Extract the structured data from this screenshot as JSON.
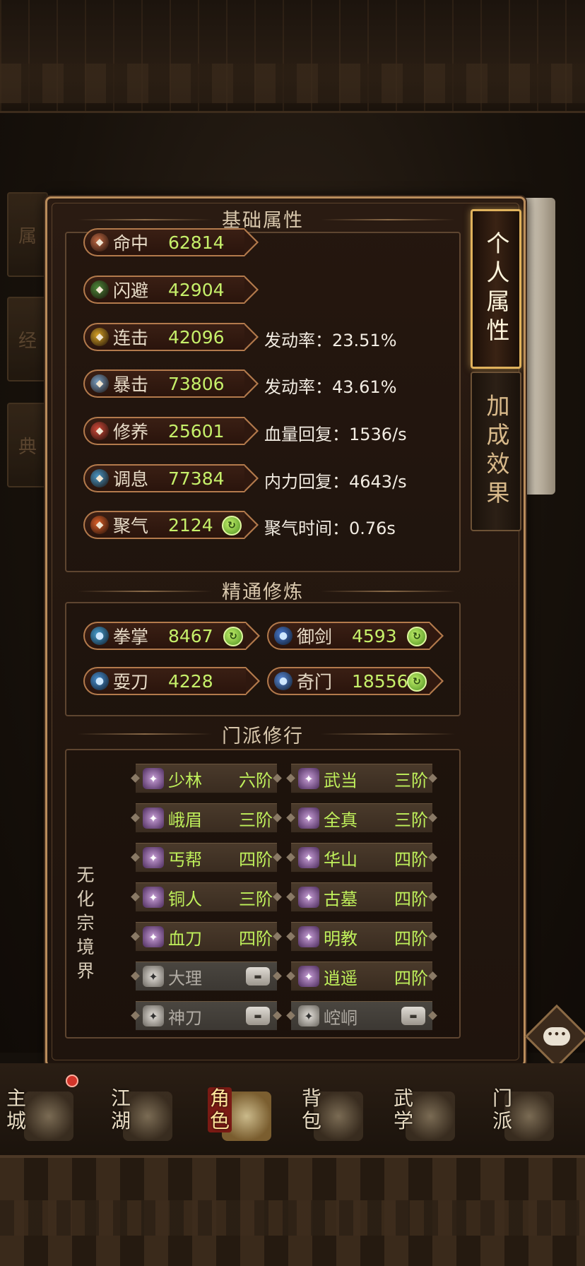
{
  "tabs": {
    "personal": "个人属性",
    "bonus": "加成效果"
  },
  "basic": {
    "title": "基础属性",
    "stats": [
      {
        "name": "命中",
        "value": "62814",
        "rate": "",
        "icon": "target-icon",
        "color": "#c26a44"
      },
      {
        "name": "闪避",
        "value": "42904",
        "rate": "",
        "icon": "dodge-icon",
        "color": "#4d8a3a"
      },
      {
        "name": "连击",
        "value": "42096",
        "rate": "发动率：23.51%",
        "icon": "lightning-icon",
        "color": "#d8a326"
      },
      {
        "name": "暴击",
        "value": "73806",
        "rate": "发动率：43.61%",
        "icon": "crit-icon",
        "color": "#7aa0c4"
      },
      {
        "name": "修养",
        "value": "25601",
        "rate": "血量回复：1536/s",
        "icon": "heart-icon",
        "color": "#d44a3a"
      },
      {
        "name": "调息",
        "value": "77384",
        "rate": "内力回复：4643/s",
        "icon": "breath-icon",
        "color": "#4a98c8"
      },
      {
        "name": "聚气",
        "value": "2124",
        "rate": "聚气时间：0.76s",
        "icon": "fire-icon",
        "color": "#e0622a"
      }
    ]
  },
  "mastery": {
    "title": "精通修炼",
    "items": [
      {
        "name": "拳掌",
        "value": "8467",
        "icon": "fist-icon",
        "color": "#4aa0d0"
      },
      {
        "name": "御剑",
        "value": "4593",
        "icon": "sword-icon",
        "color": "#4a7ad0"
      },
      {
        "name": "耍刀",
        "value": "4228",
        "icon": "blade-icon",
        "color": "#4a90d0"
      },
      {
        "name": "奇门",
        "value": "18556",
        "icon": "strange-icon",
        "color": "#5a8ad8"
      }
    ]
  },
  "sects": {
    "title": "门派修行",
    "realm_label": "无化宗境界",
    "left": [
      {
        "name": "少林",
        "rank": "六阶",
        "locked": false,
        "icon": "shaolin-icon"
      },
      {
        "name": "峨眉",
        "rank": "三阶",
        "locked": false,
        "icon": "emei-icon"
      },
      {
        "name": "丐帮",
        "rank": "四阶",
        "locked": false,
        "icon": "beggar-icon"
      },
      {
        "name": "铜人",
        "rank": "三阶",
        "locked": false,
        "icon": "bronze-icon"
      },
      {
        "name": "血刀",
        "rank": "四阶",
        "locked": false,
        "icon": "bloodblade-icon"
      },
      {
        "name": "大理",
        "rank": "",
        "locked": true,
        "icon": "dali-icon"
      },
      {
        "name": "神刀",
        "rank": "",
        "locked": true,
        "icon": "divineblade-icon"
      }
    ],
    "right": [
      {
        "name": "武当",
        "rank": "三阶",
        "locked": false,
        "icon": "wudang-icon"
      },
      {
        "name": "全真",
        "rank": "三阶",
        "locked": false,
        "icon": "quanzhen-icon"
      },
      {
        "name": "华山",
        "rank": "四阶",
        "locked": false,
        "icon": "huashan-icon"
      },
      {
        "name": "古墓",
        "rank": "四阶",
        "locked": false,
        "icon": "tomb-icon"
      },
      {
        "name": "明教",
        "rank": "四阶",
        "locked": false,
        "icon": "mingjiao-icon"
      },
      {
        "name": "逍遥",
        "rank": "四阶",
        "locked": false,
        "icon": "xiaoyao-icon"
      },
      {
        "name": "崆峒",
        "rank": "",
        "locked": true,
        "icon": "kongtong-icon"
      }
    ]
  },
  "nav": [
    {
      "label": "主城",
      "active": false
    },
    {
      "label": "江湖",
      "active": false
    },
    {
      "label": "角色",
      "active": true
    },
    {
      "label": "背包",
      "active": false
    },
    {
      "label": "武学",
      "active": false
    },
    {
      "label": "门派",
      "active": false
    }
  ]
}
